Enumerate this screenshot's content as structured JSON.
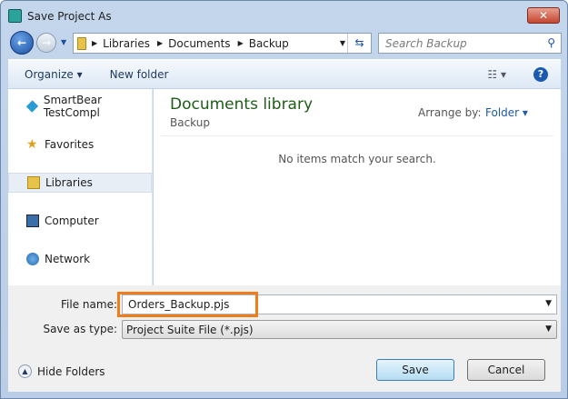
{
  "window": {
    "title": "Save Project As",
    "close": "✕"
  },
  "nav": {
    "breadcrumbs": [
      "Libraries",
      "Documents",
      "Backup"
    ],
    "search_placeholder": "Search Backup"
  },
  "toolbar": {
    "organize": "Organize ▾",
    "new_folder": "New folder",
    "views": "☷ ▾",
    "help": "?"
  },
  "sidebar": {
    "items": [
      {
        "label": "SmartBear TestCompl",
        "icon": "smartbear-icon"
      },
      {
        "label": "Favorites",
        "icon": "star-icon"
      },
      {
        "label": "Libraries",
        "icon": "libraries-icon",
        "selected": true
      },
      {
        "label": "Computer",
        "icon": "computer-icon"
      },
      {
        "label": "Network",
        "icon": "network-icon"
      }
    ]
  },
  "main": {
    "title": "Documents library",
    "subtitle": "Backup",
    "arrange_label": "Arrange by:",
    "arrange_value": "Folder ▾",
    "empty": "No items match your search."
  },
  "form": {
    "file_name_label": "File name:",
    "file_name": "Orders_Backup.pjs",
    "type_label": "Save as type:",
    "type_value": "Project Suite File  (*.pjs)"
  },
  "buttons": {
    "hide_folders": "Hide Folders",
    "save": "Save",
    "cancel": "Cancel"
  }
}
